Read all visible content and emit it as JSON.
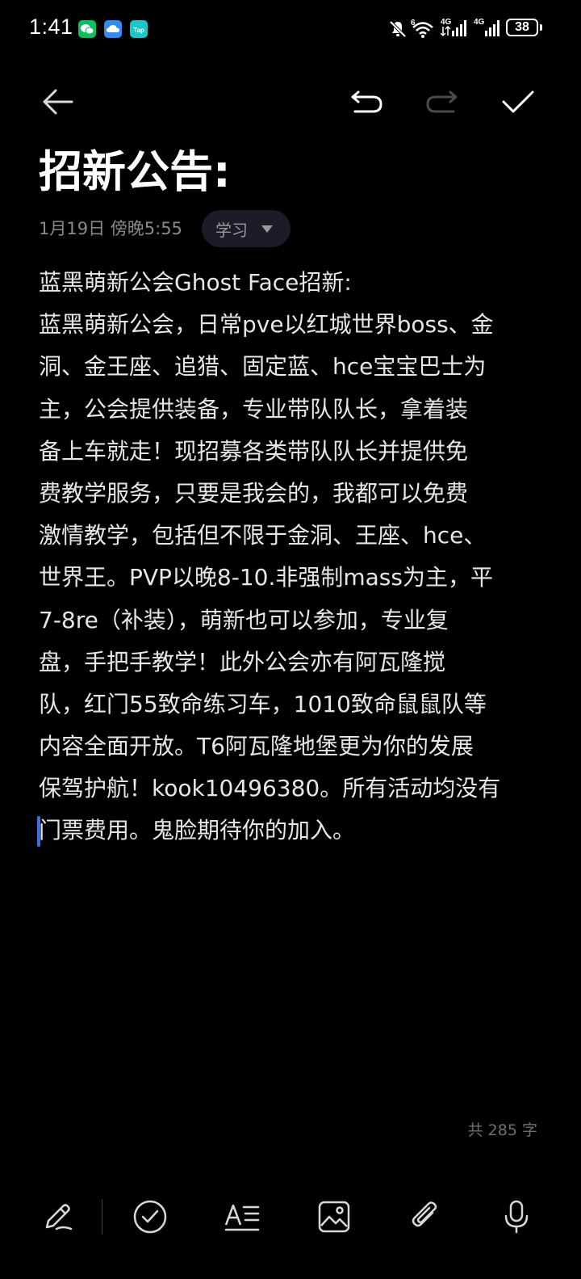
{
  "status_bar": {
    "time": "1:41",
    "app_icons": [
      "wechat-icon",
      "cloud-icon",
      "taptap-icon"
    ],
    "tap_label": "Tap",
    "signal_1_label": "4G",
    "signal_2_label": "4G",
    "wifi_label": "6",
    "battery_level": "38"
  },
  "toolbar": {
    "back_icon": "arrow-left-icon",
    "undo_icon": "undo-icon",
    "redo_icon": "redo-icon",
    "confirm_icon": "check-icon"
  },
  "note": {
    "title": "招新公告:",
    "date": "1月19日 傍晚5:55",
    "category": "学习",
    "body_lines": [
      "蓝黑萌新公会Ghost Face招新:",
      "蓝黑萌新公会，日常pve以红城世界boss、金",
      "洞、金王座、追猎、固定蓝、hce宝宝巴士为",
      "主，公会提供装备，专业带队队长，拿着装",
      "备上车就走！现招募各类带队队长并提供免",
      "费教学服务，只要是我会的，我都可以免费",
      "激情教学，包括但不限于金洞、王座、hce、",
      "世界王。PVP以晚8-10.非强制mass为主，平",
      "7-8re（补装），萌新也可以参加，专业复",
      "盘，手把手教学！此外公会亦有阿瓦隆搅",
      "队，红门55致命练习车，1010致命鼠鼠队等",
      "内容全面开放。T6阿瓦隆地堡更为你的发展",
      "保驾护航！kook10496380。所有活动均没有",
      "门票费用。鬼脸期待你的加入。"
    ],
    "word_count": "共 285 字"
  },
  "bottom_toolbar": {
    "items": [
      "pen-icon",
      "checklist-icon",
      "text-format-icon",
      "image-icon",
      "attachment-icon",
      "microphone-icon"
    ]
  },
  "colors": {
    "background": "#000000",
    "text": "#e6e6e6",
    "muted": "#8a8a8a",
    "cursor": "#3b6fe8",
    "pill": "#1f1a27"
  }
}
